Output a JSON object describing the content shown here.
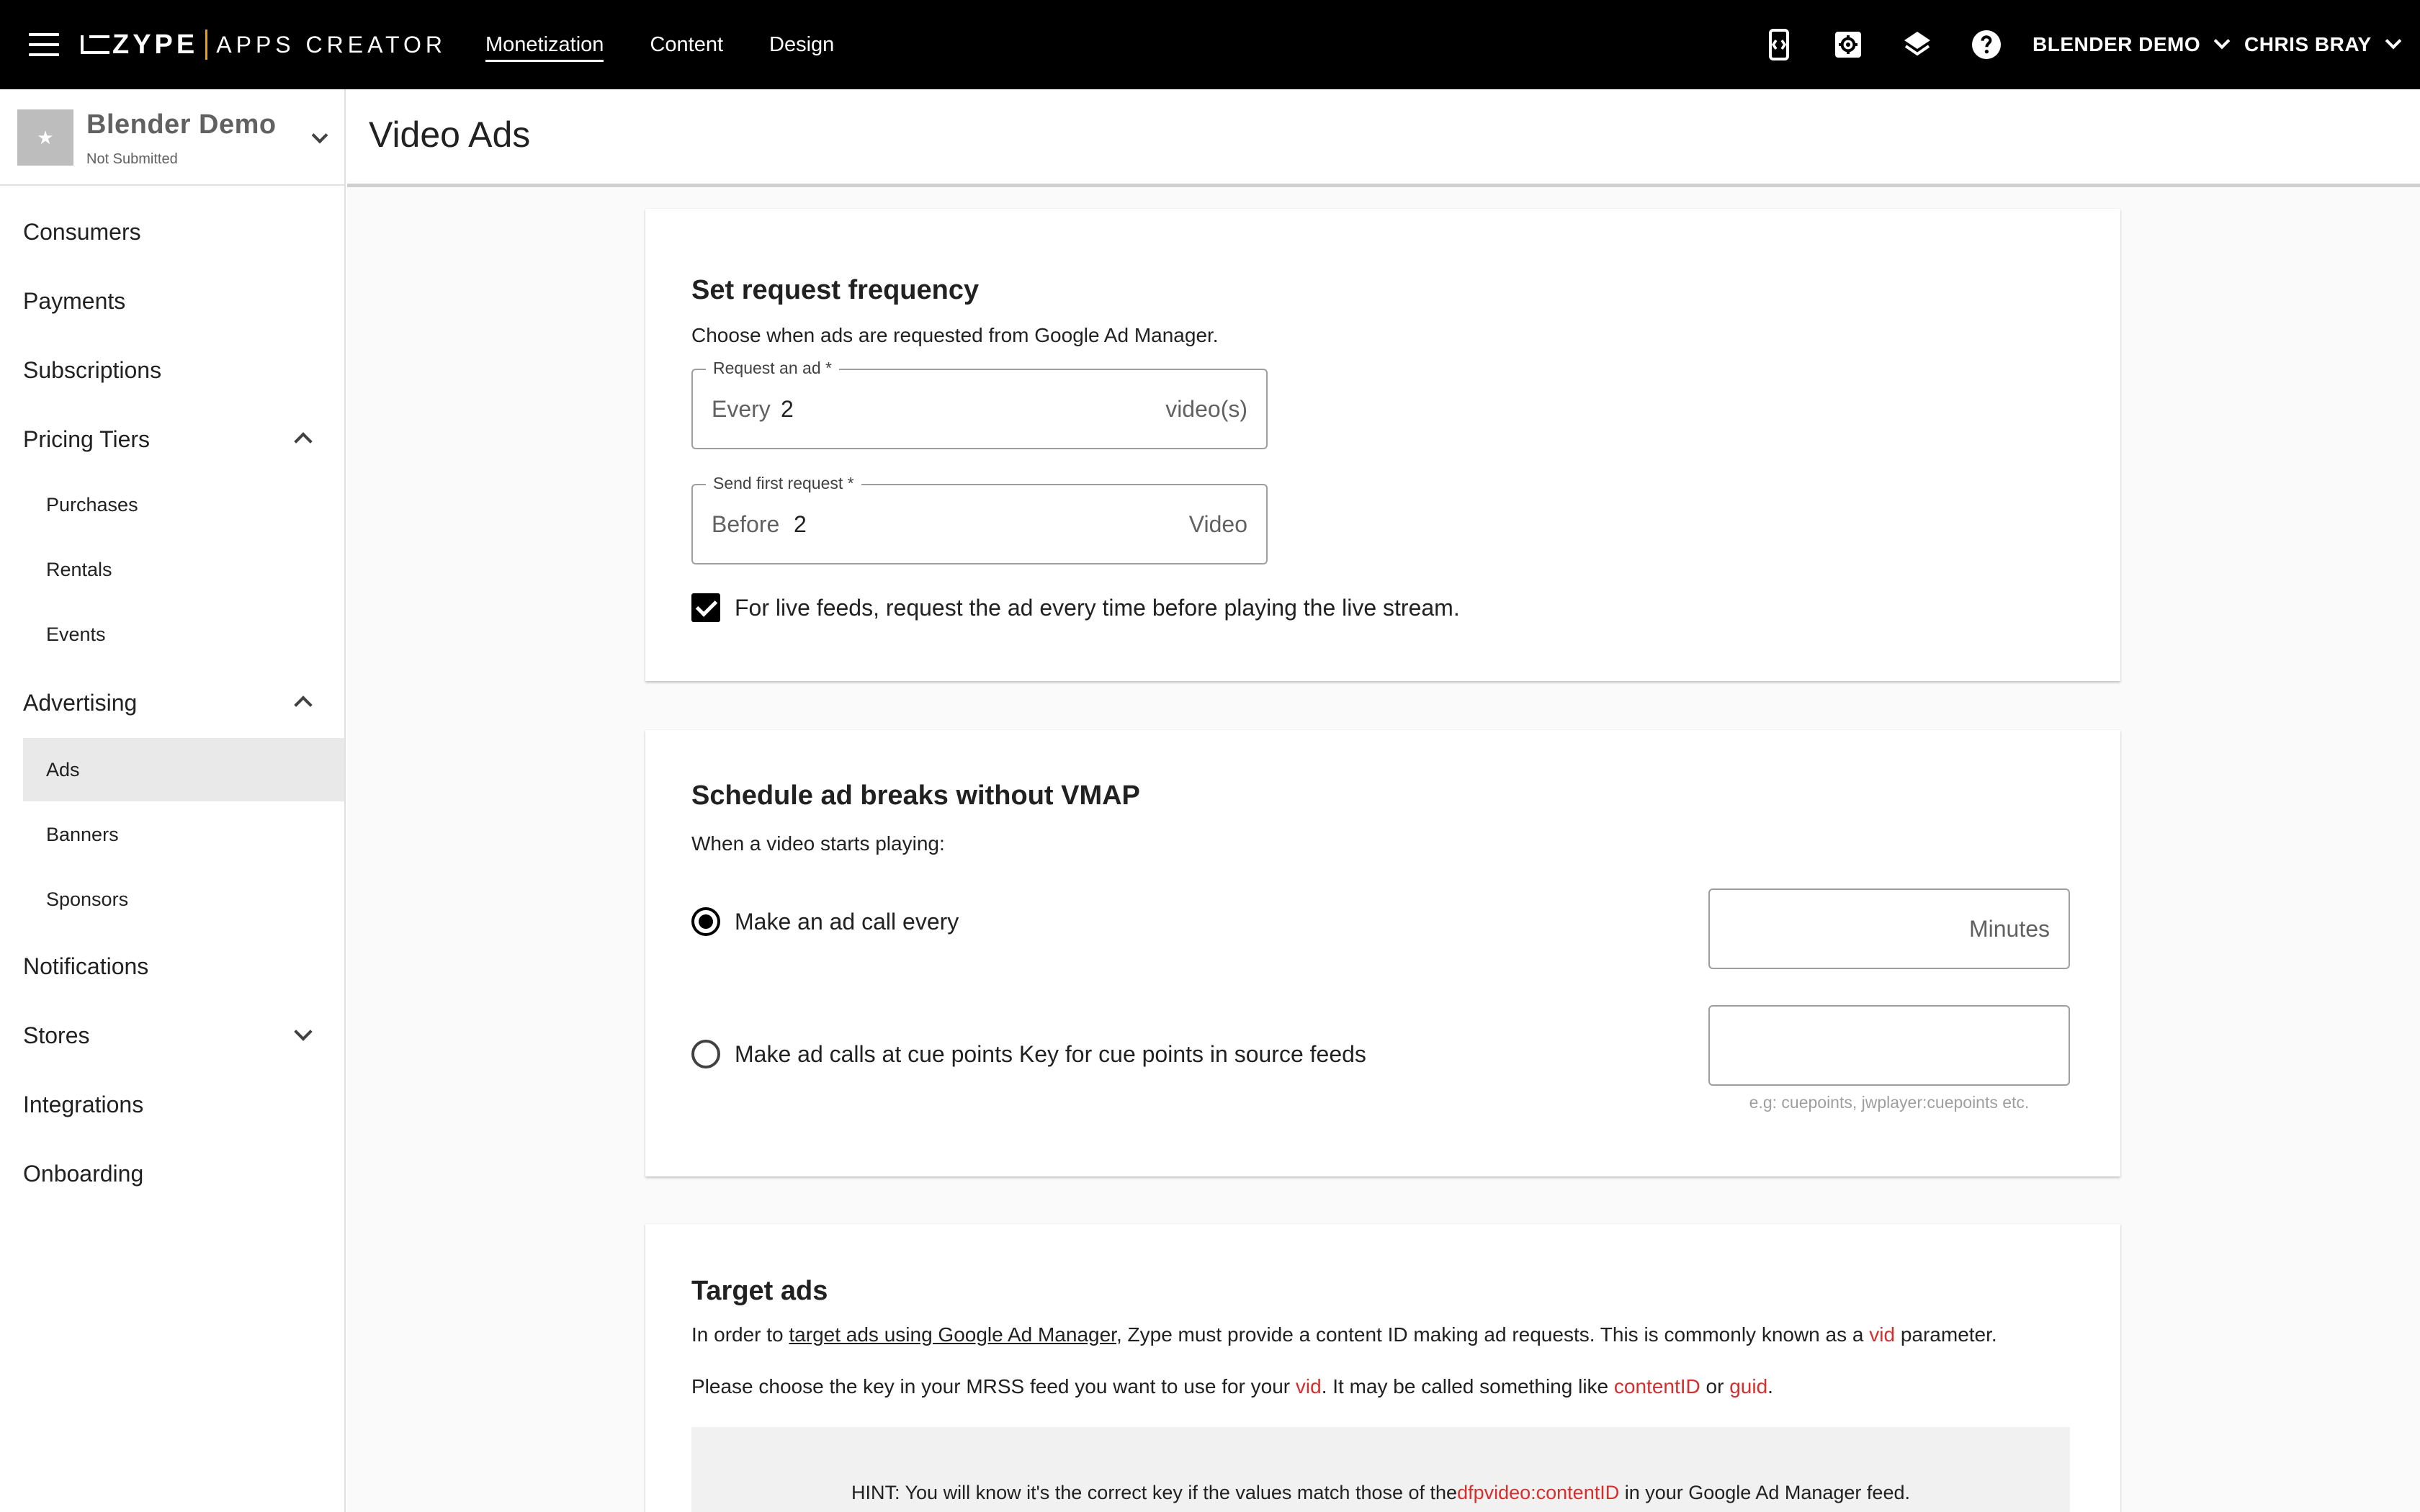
{
  "topbar": {
    "logo_text": "ZYPE",
    "logo_subtext": "APPS CREATOR",
    "nav": [
      {
        "label": "Monetization",
        "active": true
      },
      {
        "label": "Content",
        "active": false
      },
      {
        "label": "Design",
        "active": false
      }
    ],
    "icons": [
      "code-device-icon",
      "settings-box-icon",
      "layers-icon",
      "help-icon"
    ],
    "account_label": "BLENDER DEMO",
    "user_label": "CHRIS BRAY"
  },
  "sidebar": {
    "app_name": "Blender Demo",
    "app_status": "Not Submitted",
    "items": {
      "consumers": "Consumers",
      "payments": "Payments",
      "subscriptions": "Subscriptions",
      "pricing_tiers": "Pricing Tiers",
      "purchases": "Purchases",
      "rentals": "Rentals",
      "events": "Events",
      "advertising": "Advertising",
      "ads": "Ads",
      "banners": "Banners",
      "sponsors": "Sponsors",
      "notifications": "Notifications",
      "stores": "Stores",
      "integrations": "Integrations",
      "onboarding": "Onboarding"
    },
    "active_item": "Ads"
  },
  "page": {
    "title": "Video Ads"
  },
  "frequency": {
    "heading": "Set request frequency",
    "description": "Choose when ads are requested from Google Ad Manager.",
    "request_ad": {
      "label": "Request an ad *",
      "prefix": "Every",
      "value": "2",
      "suffix": "video(s)"
    },
    "first_request": {
      "label": "Send first request *",
      "prefix": "Before",
      "value": "2",
      "suffix": "Video"
    },
    "live_checkbox": {
      "label": "For live feeds, request the ad every time before playing the live stream.",
      "checked": true
    }
  },
  "schedule": {
    "heading": "Schedule ad breaks without VMAP",
    "description": "When a video starts playing:",
    "option_interval": {
      "label": "Make an ad call every",
      "selected": true,
      "suffix": "Minutes",
      "value": ""
    },
    "option_cuepoints": {
      "label": "Make ad calls at cue points Key for cue points in source feeds",
      "selected": false,
      "value": "",
      "hint": "e.g: cuepoints, jwplayer:cuepoints etc."
    }
  },
  "target": {
    "heading": "Target ads",
    "p1_before": "In order to ",
    "p1_link": "target ads using Google Ad Manager",
    "p1_mid": ", Zype must provide a content ID making ad requests. This is commonly known as a ",
    "p1_code": "vid",
    "p1_after": " parameter.",
    "p2_before": "Please choose the key in your MRSS feed you want to use for your ",
    "p2_code1": "vid",
    "p2_mid": ". It may be called something like ",
    "p2_code2": "contentID",
    "p2_or": " or ",
    "p2_code3": "guid",
    "p2_after": ".",
    "hint_before": "HINT: You will know it's the correct key if the values match those of the",
    "hint_code": "dfpvideo:contentID",
    "hint_after": " in your Google Ad Manager feed."
  },
  "colors": {
    "topbar": "#000000",
    "accent_code": "#d32f2f",
    "logo_separator": "#e0a51a",
    "active_sidebar": "#e9e9e9"
  }
}
